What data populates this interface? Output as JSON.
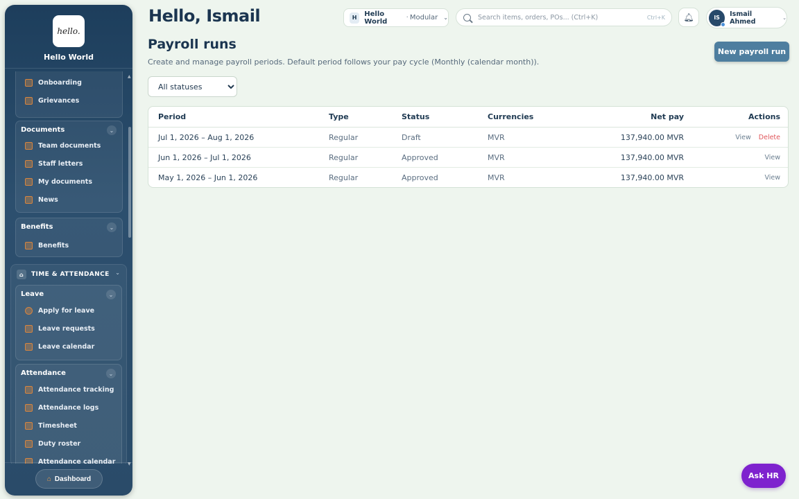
{
  "sidebar": {
    "brand_logo_text": "hello.",
    "brand_name": "Hello World",
    "groups": [
      {
        "title": "",
        "items": [
          {
            "label": "Onboarding",
            "icon": "clipboard-icon"
          },
          {
            "label": "Grievances",
            "icon": "warning-icon"
          }
        ]
      },
      {
        "title": "Documents",
        "items": [
          {
            "label": "Team documents",
            "icon": "document-icon"
          },
          {
            "label": "Staff letters",
            "icon": "letter-icon"
          },
          {
            "label": "My documents",
            "icon": "folder-icon"
          },
          {
            "label": "News",
            "icon": "news-icon"
          }
        ]
      },
      {
        "title": "Benefits",
        "items": [
          {
            "label": "Benefits",
            "icon": "heart-icon"
          }
        ]
      }
    ],
    "section": {
      "title": "TIME & ATTENDANCE",
      "groups": [
        {
          "title": "Leave",
          "items": [
            {
              "label": "Apply for leave",
              "icon": "plus-circle-icon"
            },
            {
              "label": "Leave requests",
              "icon": "calendar-icon"
            },
            {
              "label": "Leave calendar",
              "icon": "calendar-icon"
            }
          ]
        },
        {
          "title": "Attendance",
          "items": [
            {
              "label": "Attendance tracking",
              "icon": "calendar-icon"
            },
            {
              "label": "Attendance logs",
              "icon": "clipboard-icon"
            },
            {
              "label": "Timesheet",
              "icon": "grid-icon"
            },
            {
              "label": "Duty roster",
              "icon": "calendar-icon"
            },
            {
              "label": "Attendance calendar",
              "icon": "calendar-icon"
            }
          ]
        }
      ]
    },
    "footer_button": "Dashboard"
  },
  "header": {
    "greeting": "Hello, Ismail",
    "workspace": {
      "badge": "H",
      "name": "Hello World",
      "separator": "·",
      "sub": "Modular"
    },
    "search": {
      "placeholder": "Search items, orders, POs... (Ctrl+K)",
      "shortcut": "Ctrl+K"
    },
    "profile": {
      "initials": "IS",
      "name": "Ismail Ahmed"
    }
  },
  "main": {
    "title": "Payroll runs",
    "description": "Create and manage payroll periods. Default period follows your pay cycle (Monthly (calendar month)).",
    "new_button": "New payroll run",
    "filter": {
      "selected": "All statuses"
    },
    "table": {
      "columns": [
        "Period",
        "Type",
        "Status",
        "Currencies",
        "Net pay",
        "Actions"
      ],
      "rows": [
        {
          "period": "Jul 1, 2026 – Aug 1, 2026",
          "type": "Regular",
          "status": "Draft",
          "currencies": "MVR",
          "net_pay": "137,940.00 MVR",
          "view": "View",
          "delete": "Delete"
        },
        {
          "period": "Jun 1, 2026 – Jul 1, 2026",
          "type": "Regular",
          "status": "Approved",
          "currencies": "MVR",
          "net_pay": "137,940.00 MVR",
          "view": "View"
        },
        {
          "period": "May 1, 2026 – Jun 1, 2026",
          "type": "Regular",
          "status": "Approved",
          "currencies": "MVR",
          "net_pay": "137,940.00 MVR",
          "view": "View"
        }
      ]
    }
  },
  "ask_hr": "Ask HR",
  "colors": {
    "sidebar_bg": "#1d3e5c",
    "accent": "#4e7e9f",
    "ask_hr": "#7e22ce",
    "delete": "#e0565b",
    "page_bg": "#eef5ee"
  }
}
